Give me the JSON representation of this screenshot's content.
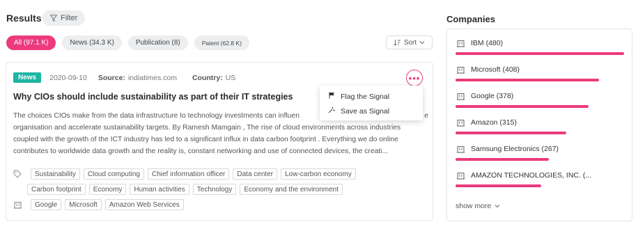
{
  "header": {
    "results_title": "Results",
    "filter_label": "Filter"
  },
  "tabs": [
    {
      "label": "All (97.1 K)",
      "active": true
    },
    {
      "label": "News (34.3 K)",
      "active": false
    },
    {
      "label": "Publication (8)",
      "active": false
    },
    {
      "label": "Patent (62.8 K)",
      "active": false
    }
  ],
  "sort": {
    "label": "Sort"
  },
  "article": {
    "type_badge": "News",
    "date": "2020-09-10",
    "source_label": "Source:",
    "source": "indiatimes.com",
    "country_label": "Country:",
    "country": "US",
    "title": "Why CIOs should include sustainability as part of their IT strategies",
    "body": "The choices CIOs make from the data infrastructure to technology investments can influence the organisation's sustainability ... organisation and accelerate sustainability targets. By Ramesh Mamgain , The rise of cloud environments across industries coupled with the growth of the ICT industry has led to a significant influx in data carbon footprint . Everything we do online contributes to worldwide data growth and the reality is, constant networking and use of connected devices, the creati...",
    "body_line1": "The choices CIOs make from the data infrastructure to technology investments can influen",
    "body_line1_tail": "e",
    "body_line2": "organisation and accelerate sustainability targets. By Ramesh Mamgain , The rise of cloud environments across industries",
    "body_line3": "coupled with the growth of the ICT industry has led to a significant influx in data carbon footprint . Everything we do online",
    "body_line4": "contributes to worldwide data growth and the reality is, constant networking and use of connected devices, the creati...",
    "topic_tags_row1": [
      "Sustainability",
      "Cloud computing",
      "Chief information officer",
      "Data center",
      "Low-carbon economy"
    ],
    "topic_tags_row2": [
      "Carbon footprint",
      "Economy",
      "Human activities",
      "Technology",
      "Economy and the environment"
    ],
    "company_tags": [
      "Google",
      "Microsoft",
      "Amazon Web Services"
    ]
  },
  "menu": {
    "items": [
      "Flag the Signal",
      "Save as Signal"
    ]
  },
  "companies": {
    "title": "Companies",
    "items": [
      {
        "label": "IBM (480)",
        "count": 480
      },
      {
        "label": "Microsoft (408)",
        "count": 408
      },
      {
        "label": "Google (378)",
        "count": 378
      },
      {
        "label": "Amazon (315)",
        "count": 315
      },
      {
        "label": "Samsung Electronics (267)",
        "count": 267
      },
      {
        "label": "AMAZON TECHNOLOGIES, INC. (...",
        "count": 250
      }
    ],
    "show_more": "show more"
  },
  "colors": {
    "accent": "#ec3a7d",
    "news_badge": "#1db5a3"
  },
  "icons": {
    "filter": "filter-icon",
    "sort": "sort-icon",
    "more": "more-dots-icon",
    "tag": "tag-icon",
    "building": "building-icon",
    "flag": "flag-icon",
    "save": "save-signal-icon",
    "chevron": "chevron-down-icon"
  }
}
